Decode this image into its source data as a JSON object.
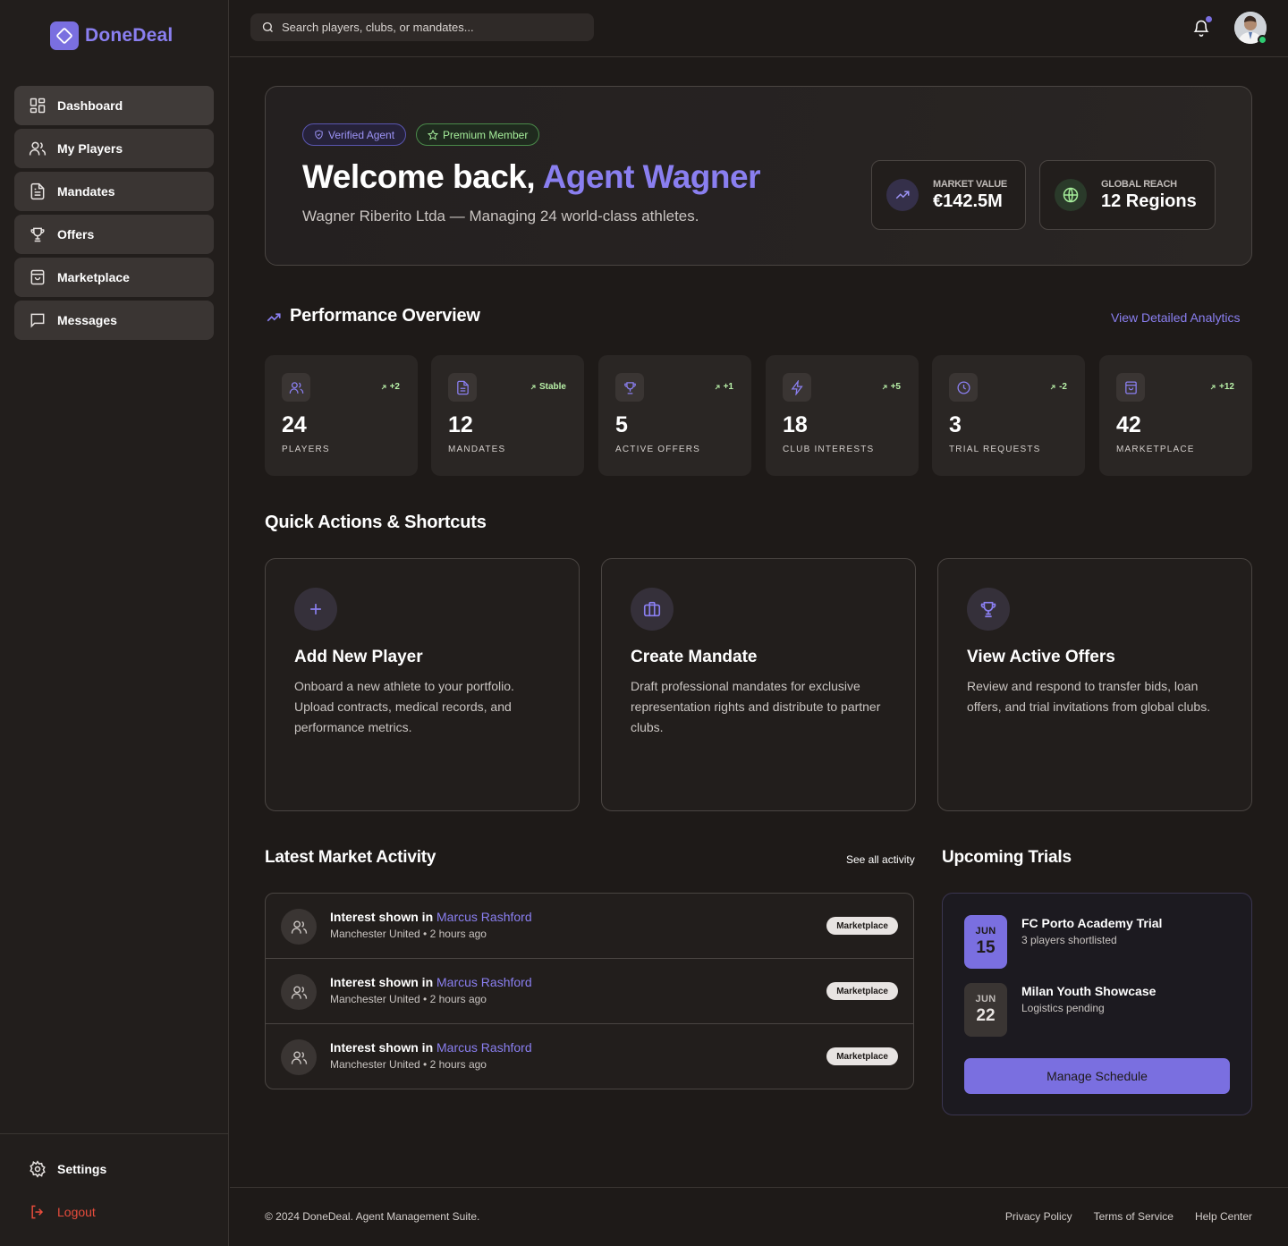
{
  "app": {
    "name": "DoneDeal"
  },
  "sidebar": {
    "items": [
      {
        "label": "Dashboard",
        "icon": "dashboard-icon"
      },
      {
        "label": "My Players",
        "icon": "users-icon"
      },
      {
        "label": "Mandates",
        "icon": "document-icon"
      },
      {
        "label": "Offers",
        "icon": "trophy-icon"
      },
      {
        "label": "Marketplace",
        "icon": "shopping-bag-icon"
      },
      {
        "label": "Messages",
        "icon": "message-icon"
      }
    ],
    "settings_label": "Settings",
    "logout_label": "Logout"
  },
  "topbar": {
    "search_placeholder": "Search players, clubs, or mandates..."
  },
  "hero": {
    "badge_verified": "Verified Agent",
    "badge_premium": "Premium Member",
    "title_prefix": "Welcome back, ",
    "title_name": "Agent Wagner",
    "subtitle": "Wagner Riberito Ltda — Managing 24 world-class athletes.",
    "market_value_label": "MARKET VALUE",
    "market_value": "€142.5M",
    "global_reach_label": "GLOBAL REACH",
    "global_reach": "12 Regions"
  },
  "performance": {
    "title": "Performance Overview",
    "link": "View Detailed Analytics",
    "kpis": [
      {
        "value": "24",
        "label": "PLAYERS",
        "trend": "+2",
        "icon": "users-icon"
      },
      {
        "value": "12",
        "label": "MANDATES",
        "trend": "Stable",
        "icon": "document-icon"
      },
      {
        "value": "5",
        "label": "ACTIVE OFFERS",
        "trend": "+1",
        "icon": "trophy-icon"
      },
      {
        "value": "18",
        "label": "CLUB INTERESTS",
        "trend": "+5",
        "icon": "lightning-icon"
      },
      {
        "value": "3",
        "label": "TRIAL REQUESTS",
        "trend": "-2",
        "icon": "clock-icon"
      },
      {
        "value": "42",
        "label": "MARKETPLACE",
        "trend": "+12",
        "icon": "shopping-bag-icon"
      }
    ]
  },
  "quick_actions": {
    "title": "Quick Actions & Shortcuts",
    "cards": [
      {
        "title": "Add New Player",
        "desc": "Onboard a new athlete to your portfolio. Upload contracts, medical records, and performance metrics.",
        "icon": "plus-icon"
      },
      {
        "title": "Create Mandate",
        "desc": "Draft professional mandates for exclusive representation rights and distribute to partner clubs.",
        "icon": "briefcase-icon"
      },
      {
        "title": "View Active Offers",
        "desc": "Review and respond to transfer bids, loan offers, and trial invitations from global clubs.",
        "icon": "trophy-icon"
      }
    ]
  },
  "activity": {
    "title": "Latest Market Activity",
    "link": "See all activity",
    "rows": [
      {
        "prefix": "Interest shown in ",
        "player": "Marcus Rashford",
        "meta": "Manchester United • 2 hours ago",
        "badge": "Marketplace"
      },
      {
        "prefix": "Interest shown in ",
        "player": "Marcus Rashford",
        "meta": "Manchester United • 2 hours ago",
        "badge": "Marketplace"
      },
      {
        "prefix": "Interest shown in ",
        "player": "Marcus Rashford",
        "meta": "Manchester United • 2 hours ago",
        "badge": "Marketplace"
      }
    ]
  },
  "trials": {
    "title": "Upcoming Trials",
    "items": [
      {
        "month": "JUN",
        "day": "15",
        "name": "FC Porto Academy Trial",
        "note": "3 players shortlisted"
      },
      {
        "month": "JUN",
        "day": "22",
        "name": "Milan Youth Showcase",
        "note": "Logistics pending"
      }
    ],
    "button": "Manage Schedule"
  },
  "footer": {
    "copyright": "© 2024 DoneDeal. Agent Management Suite.",
    "links": [
      "Privacy Policy",
      "Terms of Service",
      "Help Center"
    ]
  },
  "colors": {
    "accent": "#7a6fe0",
    "background": "#1e1a18",
    "success": "#a5ec9a",
    "danger": "#e74c3c"
  }
}
